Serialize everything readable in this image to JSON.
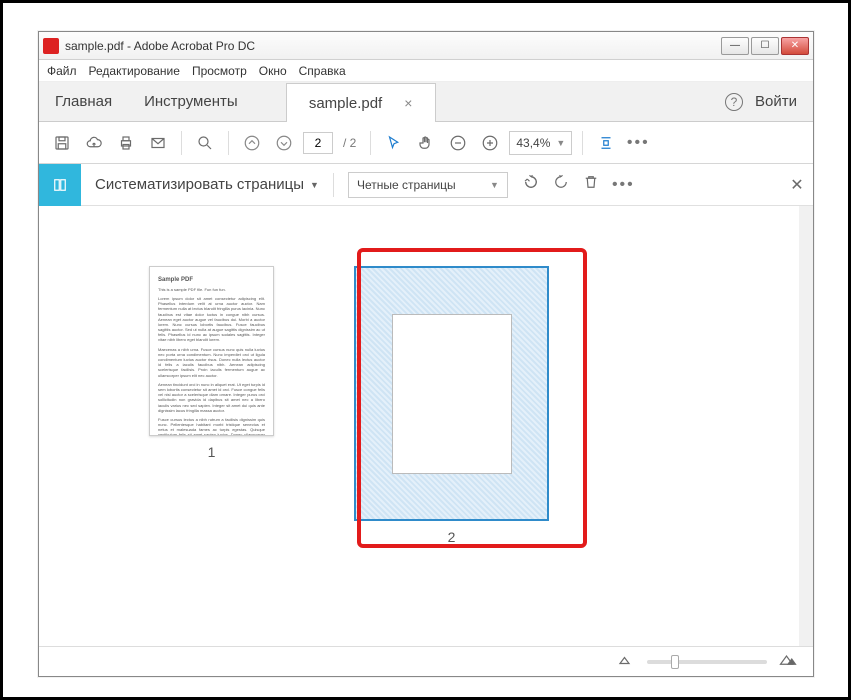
{
  "window": {
    "title": "sample.pdf - Adobe Acrobat Pro DC"
  },
  "menu": {
    "file": "Файл",
    "edit": "Редактирование",
    "view": "Просмотр",
    "window": "Окно",
    "help": "Справка"
  },
  "tabs": {
    "home": "Главная",
    "tools": "Инструменты",
    "doc": "sample.pdf",
    "login": "Войти"
  },
  "toolbar": {
    "page_current": "2",
    "page_total": "/  2",
    "zoom_value": "43,4%"
  },
  "organize": {
    "label": "Систематизировать страницы",
    "select_value": "Четные страницы"
  },
  "thumbs": {
    "p1": {
      "num": "1",
      "title": "Sample PDF",
      "subtitle": "This is a sample PDF file. Fun fun fun."
    },
    "p2": {
      "num": "2"
    }
  },
  "icons": {
    "save": "save",
    "cloud": "cloud",
    "print": "print",
    "mail": "mail",
    "search": "search",
    "up": "up",
    "down": "down",
    "cursor": "cursor",
    "hand": "hand",
    "minus": "minus",
    "plus": "plus",
    "fit": "fit",
    "rotate_ccw": "ccw",
    "rotate_cw": "cw",
    "trash": "trash",
    "thumb_small": "small",
    "thumb_large": "large"
  }
}
